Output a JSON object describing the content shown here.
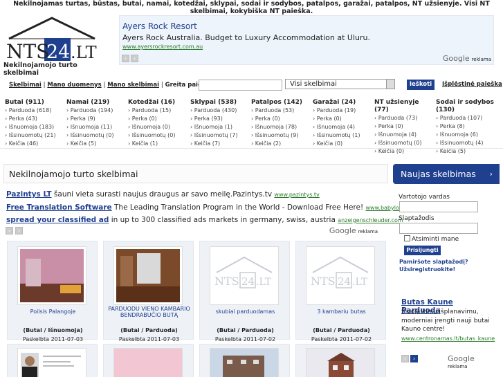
{
  "top_text": "Nekilnojamas turtas, būstas, butai, namai, kotedžai, sklypai, sodai ir sodybos, patalpos, garažai, patalpos, NT užsienyje. Visi NT skelbimai, kokybiška NT paieška.",
  "logo": {
    "left": "NTS",
    "mid": "24",
    "right": ".LT",
    "tagline": "Nekilnojamojo turto skelbimai"
  },
  "ad_top": {
    "title": "Ayers Rock Resort",
    "text": "Ayers Rock Australia. Budget to Luxury Accommodation at Uluru.",
    "url": "www.ayersrockresort.com.au",
    "google": "Google",
    "reklama": "reklama"
  },
  "nav": {
    "links": [
      "Skelbimai",
      "Mano duomenys",
      "Mano skelbimai"
    ],
    "greita": "Greita paieška",
    "select_value": "Visi skelbimai",
    "search_button": "Ieškoti",
    "advanced": "Išplėstinė paieška"
  },
  "categories": [
    {
      "head": "Butai (911)",
      "items": [
        "Parduoda (618)",
        "Perka (43)",
        "Išnuomoja (183)",
        "Išsinuomotų (21)",
        "Keičia (46)"
      ]
    },
    {
      "head": "Namai (219)",
      "items": [
        "Parduoda (194)",
        "Perka (9)",
        "Išnuomoja (11)",
        "Išsinuomotų (0)",
        "Keičia (5)"
      ]
    },
    {
      "head": "Kotedžai (16)",
      "items": [
        "Parduoda (15)",
        "Perka (0)",
        "Išnuomoja (0)",
        "Išsinuomotų (0)",
        "Keičia (1)"
      ]
    },
    {
      "head": "Sklypai (538)",
      "items": [
        "Parduoda (430)",
        "Perka (93)",
        "Išnuomoja (1)",
        "Išsinuomotų (7)",
        "Keičia (7)"
      ]
    },
    {
      "head": "Patalpos (142)",
      "items": [
        "Parduoda (53)",
        "Perka (0)",
        "Išnuomoja (78)",
        "Išsinuomotų (9)",
        "Keičia (2)"
      ]
    },
    {
      "head": "Garažai (24)",
      "items": [
        "Parduoda (19)",
        "Perka (0)",
        "Išnuomoja (4)",
        "Išsinuomotų (1)",
        "Keičia (0)"
      ]
    },
    {
      "head": "NT užsienyje (77)",
      "items": [
        "Parduoda (73)",
        "Perka (0)",
        "Išnuomoja (4)",
        "Išsinuomotų (0)",
        "Keičia (0)"
      ]
    },
    {
      "head": "Sodai ir sodybos (130)",
      "items": [
        "Parduoda (107)",
        "Perka (8)",
        "Išnuomoja (6)",
        "Išsinuomotų (4)",
        "Keičia (5)"
      ]
    }
  ],
  "main": {
    "title": "Nekilnojamojo turto skelbimai",
    "ads": [
      {
        "title": "Pazintys LT",
        "text": "šauni vieta surasti naujus draugus ar savo meilę.Pazintys.tv",
        "url": "www.pazintys.tv"
      },
      {
        "title": "Free Translation Software",
        "text": "The Leading Translation Program in the World - Download Free Here!",
        "url": "www.babylon.com"
      },
      {
        "title": "spread your classified ad",
        "text": "in up to 300 classified ads markets in germany, swiss, austria",
        "url": "anzeigenschleuder.com"
      }
    ],
    "google": "Google",
    "reklama": "reklama"
  },
  "listings": [
    {
      "title": "Poilsis Palangoje",
      "type": "(Butai / Išnuomoja)",
      "date": "Paskelbta 2011-07-03",
      "photo": "room-photo"
    },
    {
      "title": "PARDUODU VIENO KAMBARIO BENDRABUČIO BUTĄ",
      "type": "(Butai / Parduoda)",
      "date": "Paskelbta 2011-07-03",
      "photo": "room-photo"
    },
    {
      "title": "skubiai parduodamas",
      "type": "(Butai / Parduoda)",
      "date": "Paskelbta 2011-07-02",
      "photo": "placeholder-logo"
    },
    {
      "title": "3 kambariu butas",
      "type": "(Butai / Parduoda)",
      "date": "Paskelbta 2011-07-02",
      "photo": "placeholder-logo"
    }
  ],
  "sidebar": {
    "header": "Naujas skelbimas",
    "username_label": "Vartotojo vardas",
    "password_label": "Slaptažodis",
    "remember": "Atsiminti mane",
    "login_button": "Prisijungti",
    "forgot": "Pamiršote slaptažodį?",
    "register": "Užsiregistruokite!",
    "ad": {
      "title": "Butas Kaune Parduoda",
      "text": "Šiuolaikiniu išplanavimu, moderniai įrengti nauji butai Kauno centre!",
      "url": "www.centronamas.lt/butas_kaune",
      "google": "Google",
      "reklama": "reklama"
    }
  },
  "colors": {
    "brand": "#1f3f8f",
    "ad_bg": "#eef4fb",
    "url_green": "#2a7a2a"
  }
}
